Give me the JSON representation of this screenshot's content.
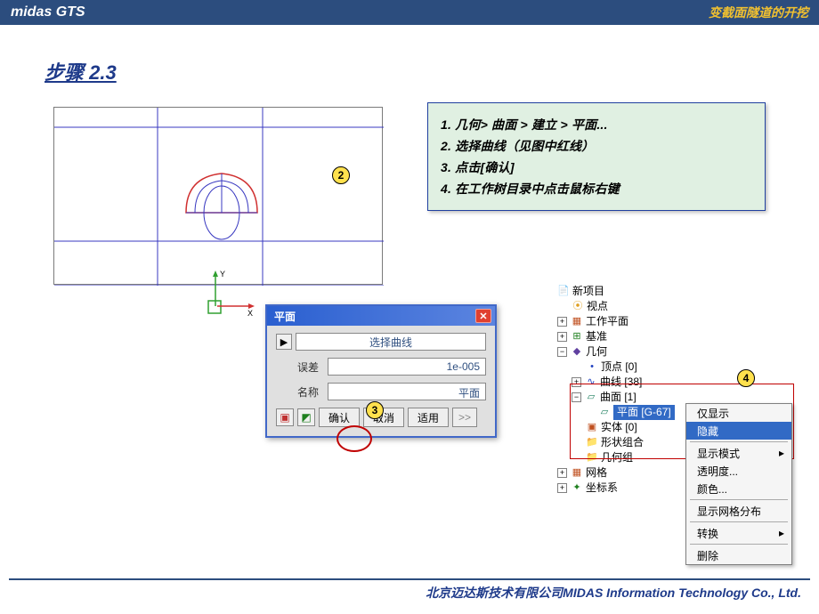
{
  "header": {
    "title": "midas GTS",
    "subtitle": "变截面隧道的开挖"
  },
  "step": "步骤 2.3",
  "instructions": {
    "lines": [
      "1. 几何> 曲面 > 建立 > 平面...",
      "2. 选择曲线（见图中红线）",
      "3. 点击[确认]",
      "4. 在工作树目录中点击鼠标右键"
    ]
  },
  "annotations": {
    "a2": "2",
    "a3": "3",
    "a4": "4"
  },
  "dialog": {
    "title": "平面",
    "select_curve": "选择曲线",
    "tolerance_label": "误差",
    "tolerance_value": "1e-005",
    "name_label": "名称",
    "name_value": "平面",
    "ok": "确认",
    "cancel": "取消",
    "apply": "适用",
    "next": ">>"
  },
  "tree": {
    "project": "新项目",
    "viewpoint": "视点",
    "workplane": "工作平面",
    "datum": "基准",
    "geometry": "几何",
    "vertex": "顶点 [0]",
    "curve": "曲线 [38]",
    "surface": "曲面 [1]",
    "plane_node": "平面 [G-67]",
    "solid": "实体 [0]",
    "shape_group": "形状组合",
    "geo_group": "几何组",
    "mesh": "网格",
    "coord": "坐标系"
  },
  "context_menu": {
    "show_only": "仅显示",
    "hide": "隐藏",
    "display_mode": "显示模式",
    "transparency": "透明度...",
    "color": "颜色...",
    "show_mesh": "显示网格分布",
    "transform": "转换",
    "delete": "删除"
  },
  "footer": "北京迈达斯技术有限公司MIDAS Information Technology Co., Ltd."
}
